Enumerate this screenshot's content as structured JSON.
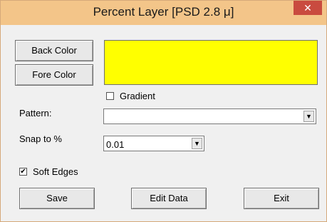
{
  "window": {
    "title": "Percent Layer [PSD 2.8 μ]",
    "close_label": "✕"
  },
  "buttons": {
    "back_color": "Back Color",
    "fore_color": "Fore Color",
    "save": "Save",
    "edit_data": "Edit Data",
    "exit": "Exit"
  },
  "color_preview": {
    "color": "#ffff00"
  },
  "gradient": {
    "label": "Gradient",
    "checked": false
  },
  "pattern": {
    "label": "Pattern:",
    "value": ""
  },
  "snap": {
    "label": "Snap to %",
    "value": "0.01"
  },
  "soft_edges": {
    "label": "Soft Edges",
    "checked": true,
    "mark": "✔"
  },
  "icons": {
    "dropdown_arrow": "▼"
  }
}
